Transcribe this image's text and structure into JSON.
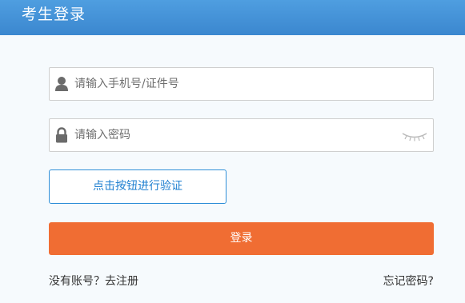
{
  "header": {
    "title": "考生登录"
  },
  "form": {
    "username_placeholder": "请输入手机号/证件号",
    "username_value": "",
    "password_placeholder": "请输入密码",
    "password_value": "",
    "user_icon": "user-icon",
    "lock_icon": "lock-icon",
    "password_toggle_icon": "eye-closed-icon",
    "verify_label": "点击按钮进行验证",
    "login_label": "登录"
  },
  "footer": {
    "register_label": "没有账号？去注册",
    "forgot_label": "忘记密码?"
  },
  "colors": {
    "header": "#3b87cf",
    "verify_border": "#2f8fd8",
    "verify_text": "#1e7fd0",
    "login_button": "#f06d33",
    "background": "#f6fafd"
  }
}
